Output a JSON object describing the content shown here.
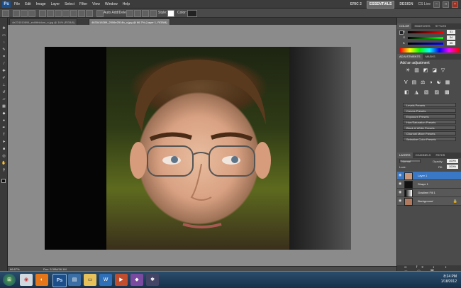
{
  "app": {
    "logo": "Ps",
    "menus": [
      "File",
      "Edit",
      "Image",
      "Layer",
      "Select",
      "Filter",
      "View",
      "Window",
      "Help"
    ],
    "workspaces": [
      "ERIC 2",
      "ESSENTIALS",
      "DESIGN"
    ],
    "active_workspace": "ESSENTIALS",
    "cs_live": "CS Live"
  },
  "options_bar": {
    "auto_add_delete": "Auto Add/Delete",
    "style_label": "Style:",
    "color_label": "Color:"
  },
  "tabs": [
    {
      "label": "4e274010894_exit/tthldom_n.jpg @ 16% (RGB/8)",
      "active": false
    },
    {
      "label": "4633418289_2006e2514b_o.jpg @ 66.7% (Layer 1, RGB/8)",
      "active": true
    }
  ],
  "status": {
    "zoom": "66.67%",
    "doc": "Doc: 5.39M/16.1M"
  },
  "color_panel": {
    "tabs": [
      "COLOR",
      "SWATCHES",
      "STYLES"
    ],
    "channels": [
      {
        "name": "R",
        "value": "31"
      },
      {
        "name": "G",
        "value": "34"
      },
      {
        "name": "B",
        "value": "35"
      }
    ]
  },
  "adjustments_panel": {
    "tabs": [
      "ADJUSTMENTS",
      "MASKS"
    ],
    "title": "Add an adjustment",
    "presets": [
      "Levels Presets",
      "Curves Presets",
      "Exposure Presets",
      "Hue/Saturation Presets",
      "Black & White Presets",
      "Channel Mixer Presets",
      "Selective Color Presets"
    ]
  },
  "layers_panel": {
    "tabs": [
      "LAYERS",
      "CHANNELS",
      "PATHS"
    ],
    "blend_mode": "Normal",
    "opacity_label": "Opacity:",
    "opacity": "100%",
    "lock_label": "Lock:",
    "fill_label": "Fill:",
    "fill": "100%",
    "layers": [
      {
        "name": "Layer 1",
        "selected": true
      },
      {
        "name": "Shape 1",
        "selected": false
      },
      {
        "name": "Gradient Fill 1",
        "selected": false
      },
      {
        "name": "Background",
        "selected": false
      }
    ]
  },
  "taskbar": {
    "time": "8:24 PM",
    "date": "1/18/2012"
  }
}
